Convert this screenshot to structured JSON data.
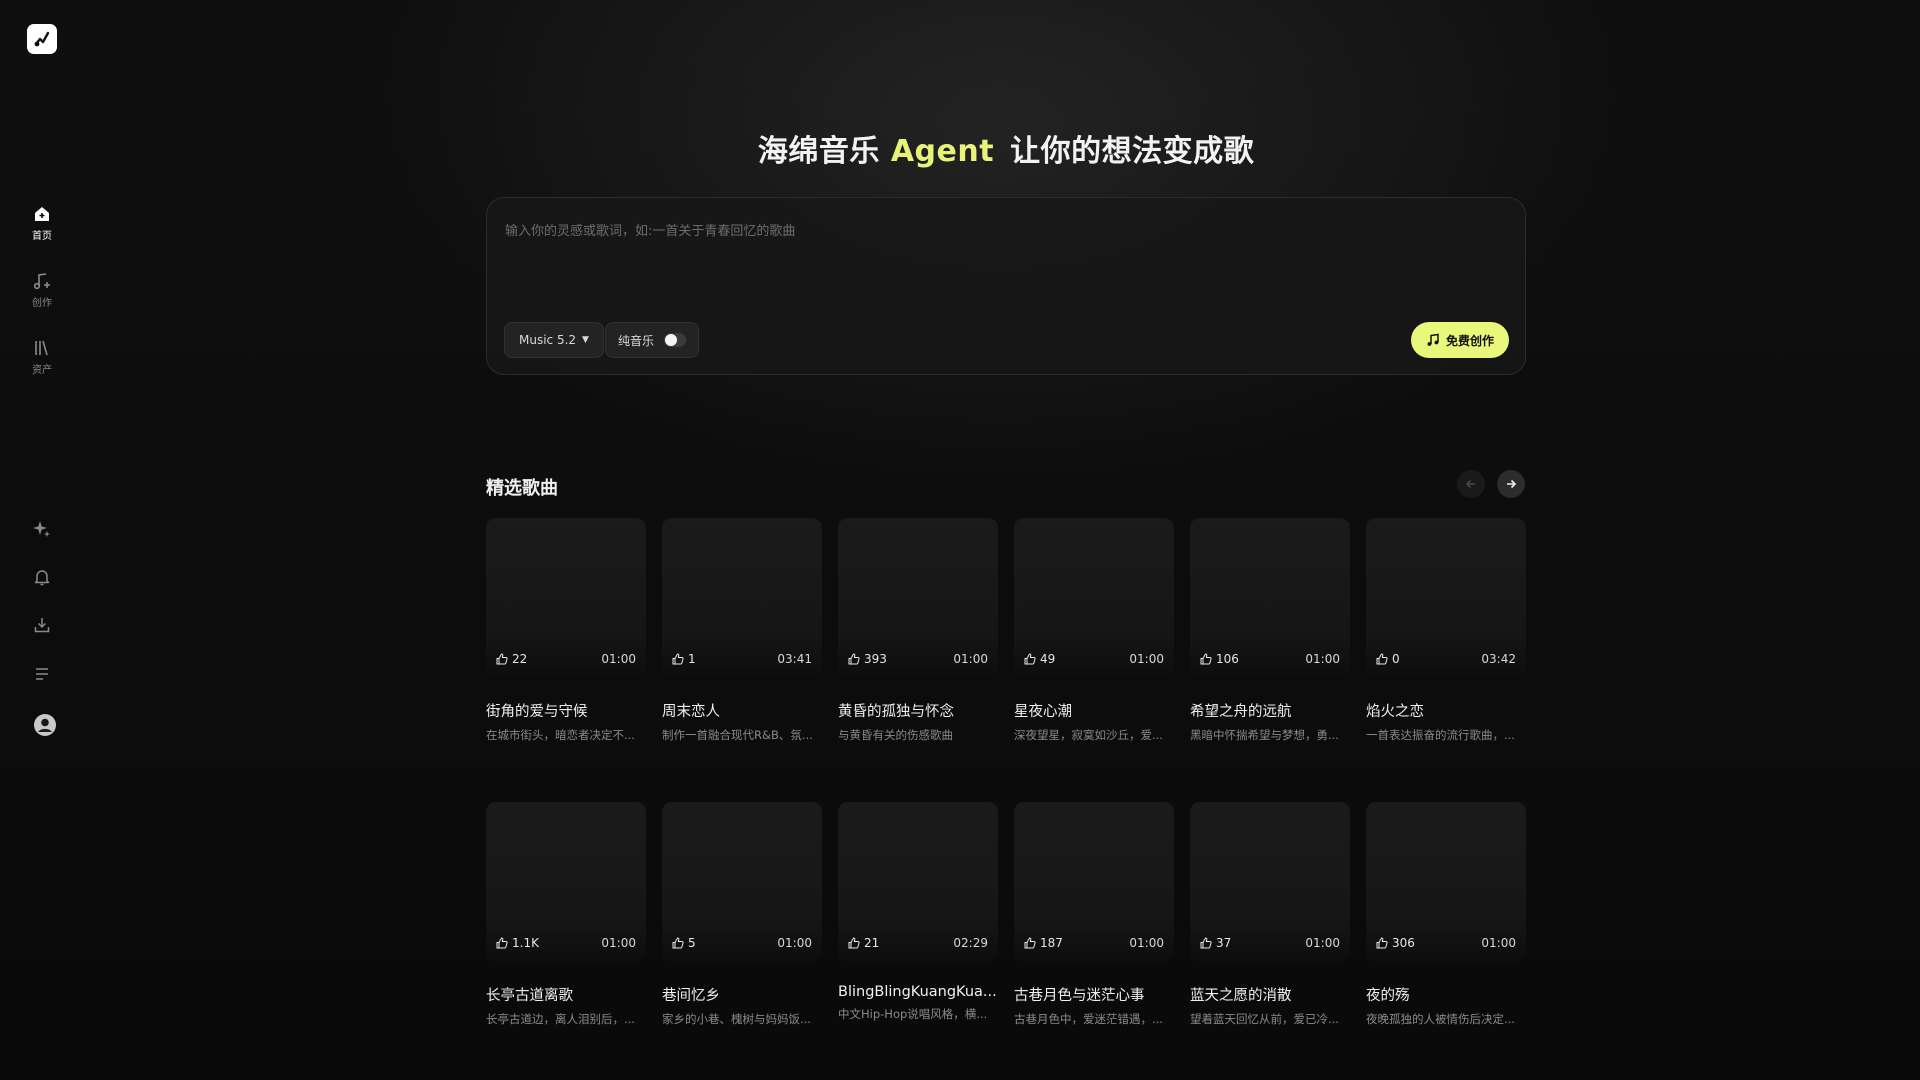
{
  "sidebar": {
    "nav": [
      {
        "label": "首页",
        "icon": "home-icon",
        "active": true
      },
      {
        "label": "创作",
        "icon": "music-note-plus-icon",
        "active": false
      },
      {
        "label": "资产",
        "icon": "library-icon",
        "active": false
      }
    ],
    "utilities": [
      "sparkle-icon",
      "bell-icon",
      "download-icon",
      "menu-lines-icon",
      "user-avatar-icon"
    ]
  },
  "hero": {
    "title_prefix": "海绵音乐",
    "title_accent": "Agent",
    "title_suffix": "让你的想法变成歌",
    "accent_color": "#e6f27a"
  },
  "prompt": {
    "placeholder": "输入你的灵感或歌词，如:一首关于青春回忆的歌曲",
    "value": "",
    "model": "Music 5.2",
    "instrumental_label": "纯音乐",
    "instrumental_on": false,
    "create_label": "免费创作"
  },
  "featured": {
    "title": "精选歌曲",
    "songs": [
      {
        "title": "街角的爱与守候",
        "desc": "在城市街头，暗恋者决定不...",
        "likes": "22",
        "duration": "01:00"
      },
      {
        "title": "周末恋人",
        "desc": "制作一首融合现代R&B、氛...",
        "likes": "1",
        "duration": "03:41"
      },
      {
        "title": "黄昏的孤独与怀念",
        "desc": "与黄昏有关的伤感歌曲",
        "likes": "393",
        "duration": "01:00"
      },
      {
        "title": "星夜心潮",
        "desc": "深夜望星，寂寞如沙丘，爱...",
        "likes": "49",
        "duration": "01:00"
      },
      {
        "title": "希望之舟的远航",
        "desc": "黑暗中怀揣希望与梦想，勇...",
        "likes": "106",
        "duration": "01:00"
      },
      {
        "title": "焰火之恋",
        "desc": "一首表达振奋的流行歌曲，...",
        "likes": "0",
        "duration": "03:42"
      },
      {
        "title": "长亭古道离歌",
        "desc": "长亭古道边，离人泪别后，...",
        "likes": "1.1K",
        "duration": "01:00"
      },
      {
        "title": "巷间忆乡",
        "desc": "家乡的小巷、槐树与妈妈饭...",
        "likes": "5",
        "duration": "01:00"
      },
      {
        "title": "BlingBlingKuangKua...",
        "desc": "中文Hip-Hop说唱风格，横...",
        "likes": "21",
        "duration": "02:29"
      },
      {
        "title": "古巷月色与迷茫心事",
        "desc": "古巷月色中，爱迷茫错遇，...",
        "likes": "187",
        "duration": "01:00"
      },
      {
        "title": "蓝天之愿的消散",
        "desc": "望着蓝天回忆从前，爱已冷...",
        "likes": "37",
        "duration": "01:00"
      },
      {
        "title": "夜的殇",
        "desc": "夜晚孤独的人被情伤后决定...",
        "likes": "306",
        "duration": "01:00"
      }
    ]
  }
}
